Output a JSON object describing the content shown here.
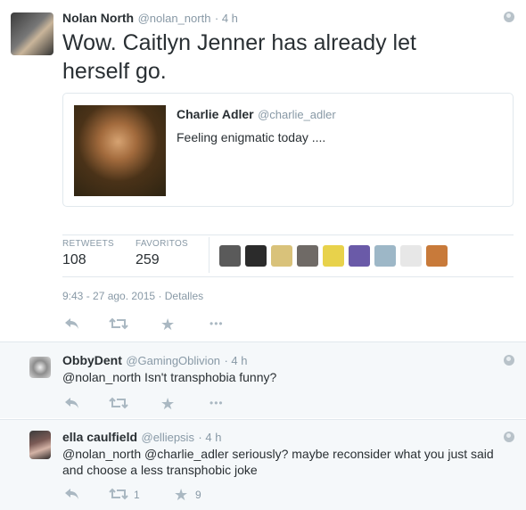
{
  "tweet": {
    "author_name": "Nolan North",
    "author_handle": "@nolan_north",
    "time": "· 4 h",
    "text": "Wow. Caitlyn Jenner has already let herself go.",
    "quoted": {
      "name": "Charlie Adler",
      "handle": "@charlie_adler",
      "text": "Feeling enigmatic today ...."
    },
    "stats": {
      "retweets_label": "RETWEETS",
      "retweets_value": "108",
      "favorites_label": "FAVORITOS",
      "favorites_value": "259"
    },
    "timestamp": "9:43 - 27 ago. 2015",
    "details_link": "· Detalles",
    "more_label": "•••"
  },
  "replies": [
    {
      "name": "ObbyDent",
      "handle": "@GamingOblivion",
      "time": "· 4 h",
      "mention": "@nolan_north",
      "text": " Isn't transphobia funny?",
      "retweet_count": "",
      "favorite_count": "",
      "more_label": "•••"
    },
    {
      "name": "ella caulfield",
      "handle": "@elliepsis",
      "time": "· 4 h",
      "mention": "@nolan_north @charlie_adler",
      "text": " seriously? maybe reconsider what you just said and choose a less transphobic joke",
      "retweet_count": "1",
      "favorite_count": "9"
    }
  ],
  "colors": {
    "link_blue": "#3b94d9",
    "muted_gray": "#8899a6",
    "icon_gray": "#aab8c2",
    "border": "#e1e8ed"
  },
  "icons": {
    "reply": "reply-icon",
    "retweet": "retweet-icon",
    "favorite": "star-icon",
    "more": "more-icon",
    "globe": "globe-icon"
  }
}
